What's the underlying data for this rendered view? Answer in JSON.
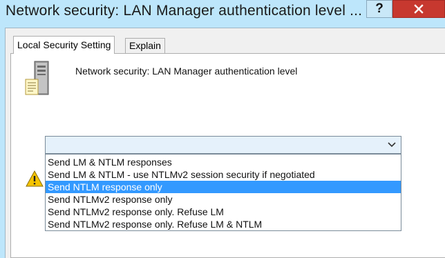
{
  "window": {
    "title": "Network security: LAN Manager authentication level ...",
    "help_label": "?"
  },
  "tabs": [
    {
      "label": "Local Security Setting",
      "active": true
    },
    {
      "label": "Explain",
      "active": false
    }
  ],
  "policy": {
    "name": "Network security: LAN Manager authentication level"
  },
  "combo": {
    "value": "",
    "expanded": true
  },
  "dropdown": {
    "options": [
      "Send LM & NTLM responses",
      "Send LM & NTLM - use NTLMv2 session security if negotiated",
      "Send NTLM response only",
      "Send NTLMv2 response only",
      "Send NTLMv2 response only. Refuse LM",
      "Send NTLMv2 response only. Refuse LM & NTLM"
    ],
    "selected_index": 2
  },
  "colors": {
    "title_bar": "#bde6fb",
    "close_button": "#c7382f",
    "selection": "#3399ff",
    "warning": "#f5c400"
  },
  "icons": {
    "policy": "server-policy-icon",
    "warning": "warning-icon",
    "close": "close-icon",
    "dropdown": "chevron-down-icon"
  }
}
